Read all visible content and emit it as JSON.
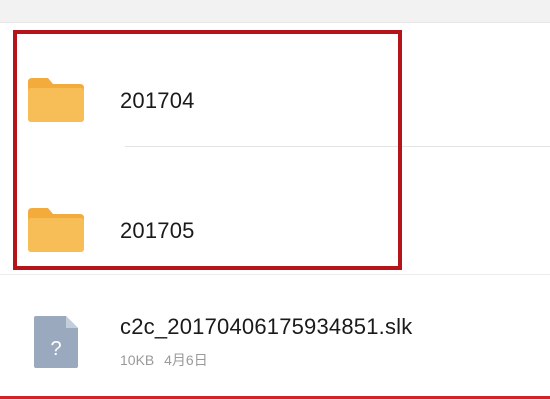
{
  "files": {
    "items": [
      {
        "type": "folder",
        "name": "201704"
      },
      {
        "type": "folder",
        "name": "201705"
      },
      {
        "type": "file",
        "name": "c2c_20170406175934851.slk",
        "size": "10KB",
        "date": "4月6日",
        "icon": "unknown-file-icon"
      }
    ]
  },
  "colors": {
    "folder": "#f7bd57",
    "folder_tab": "#f3ab3c",
    "highlight": "#b5141b",
    "file_icon": "#9aa9bd",
    "accent_line": "#d2232a"
  }
}
